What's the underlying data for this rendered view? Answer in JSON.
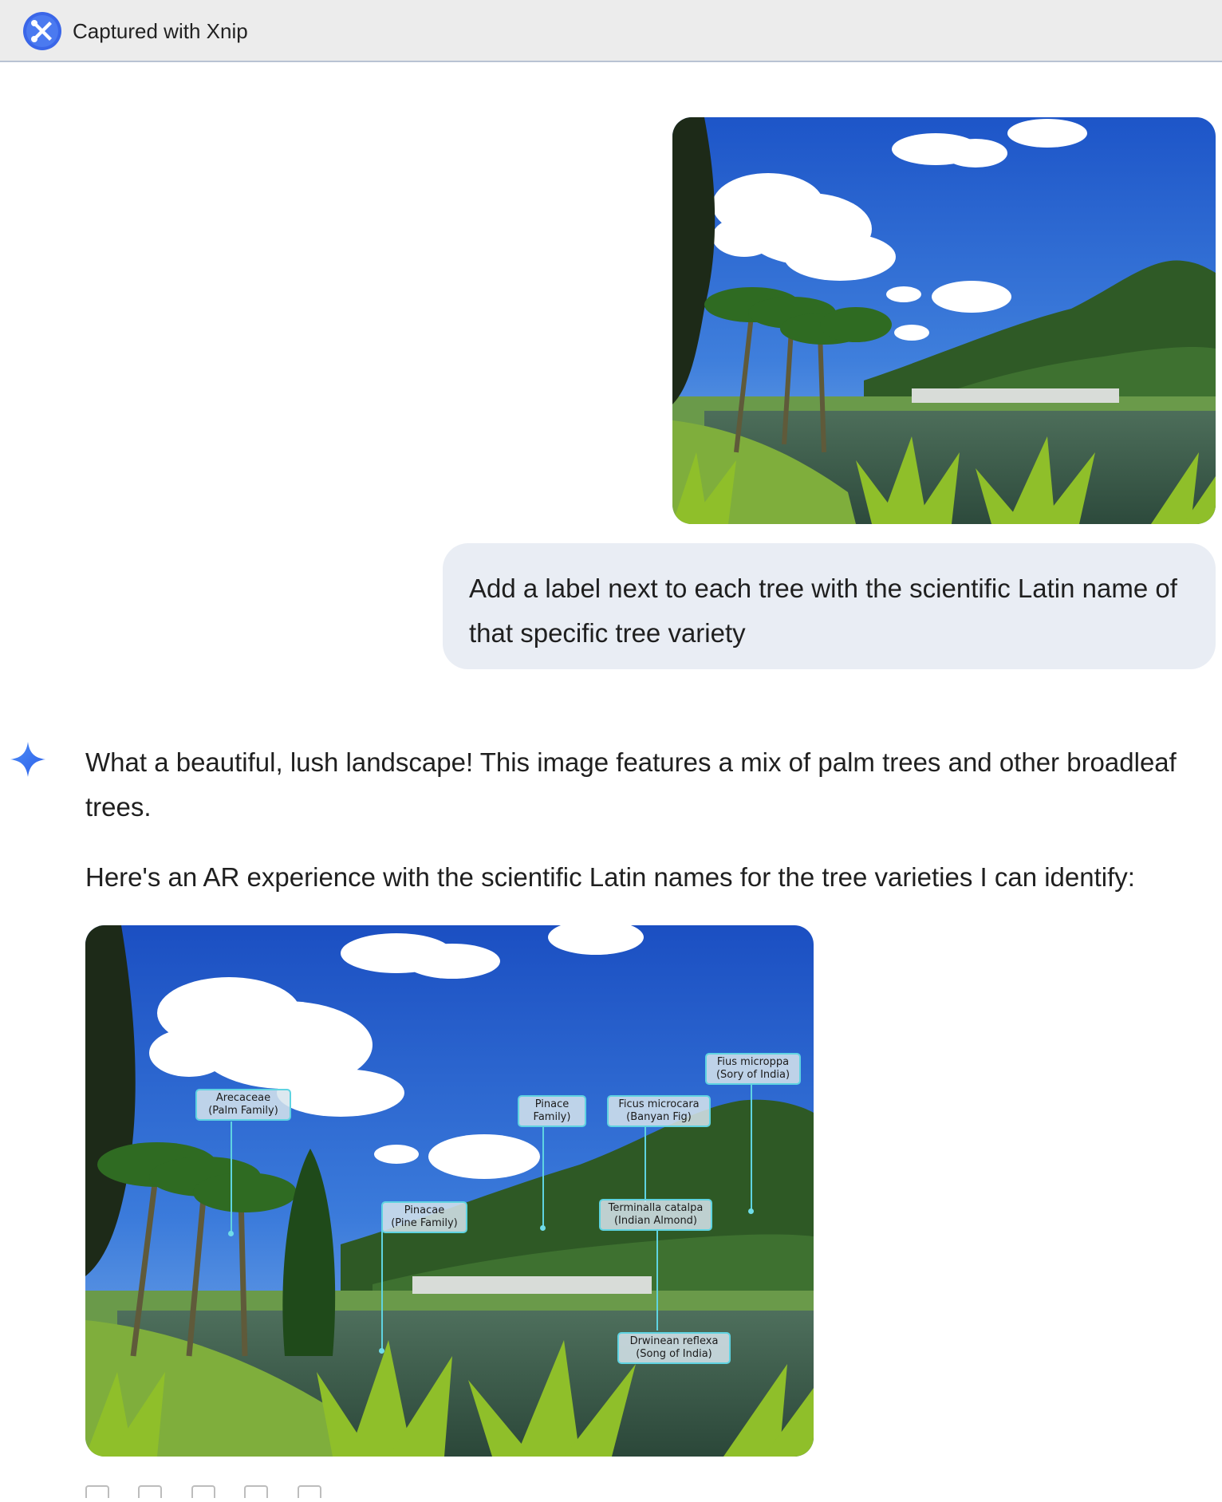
{
  "window": {
    "title": "Captured with Xnip",
    "logo_icon": "xnip-logo-icon"
  },
  "conversation": {
    "user_message": {
      "image_alt": "lake-landscape-photo",
      "text": "Add a label next to each tree with the scientific Latin name of that specific tree variety"
    },
    "assistant": {
      "avatar_icon": "gemini-spark-icon",
      "paragraph_1": "What a beautiful, lush landscape! This image features a mix of palm trees and other broadleaf trees.",
      "paragraph_2": "Here's an AR experience with the scientific Latin names for the tree varieties I can identify:",
      "image_alt": "annotated-lake-landscape-photo",
      "labels": [
        {
          "line1": "Arecaceae",
          "line2": "(Palm Family)"
        },
        {
          "line1": "Pinacae",
          "line2": "(Pine Family)"
        },
        {
          "line1": "Pinace",
          "line2": "Family)"
        },
        {
          "line1": "Ficus microcara",
          "line2": "(Banyan Fig)"
        },
        {
          "line1": "Fius microppa",
          "line2": "(Sory of India)"
        },
        {
          "line1": "Terminalla catalpa",
          "line2": "(Indian Almond)"
        },
        {
          "line1": "Drwinean reflexa",
          "line2": "(Song of India)"
        }
      ]
    }
  },
  "colors": {
    "bubble": "#e9edf4",
    "label_border": "#5fd3e1",
    "accent": "#3b6cf5"
  }
}
